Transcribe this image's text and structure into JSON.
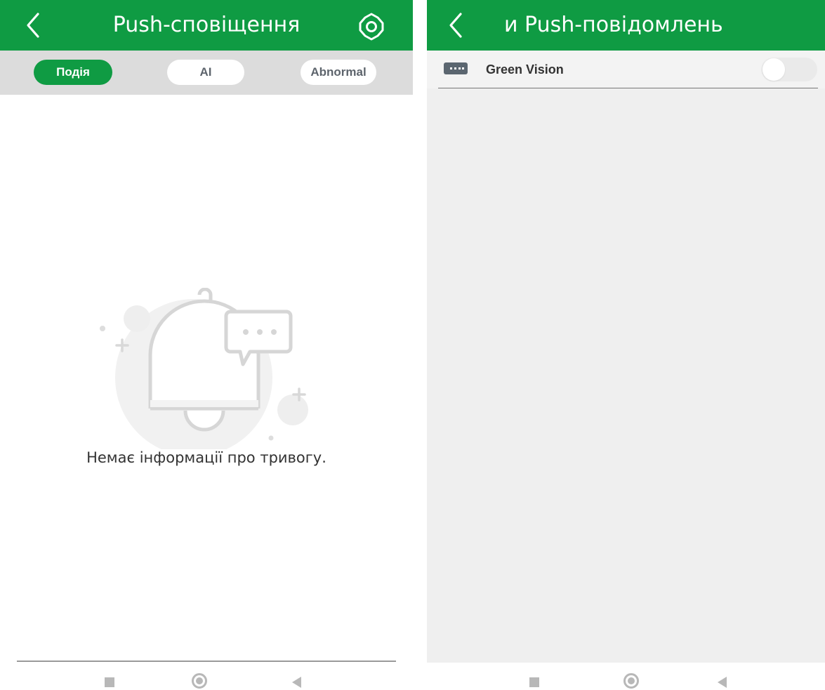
{
  "left_screen": {
    "header": {
      "title": "Push-сповіщення",
      "back_icon": "chevron-left-icon",
      "settings_icon": "gear-icon"
    },
    "tabs": [
      {
        "label": "Подія",
        "active": true
      },
      {
        "label": "AI",
        "active": false
      },
      {
        "label": "Abnormal",
        "active": false
      }
    ],
    "empty_state": {
      "icon": "bell-with-chat-icon",
      "message": "Немає інформації про тривогу."
    }
  },
  "right_screen": {
    "header": {
      "title": "и Push-повідомлень",
      "back_icon": "chevron-left-icon"
    },
    "devices": [
      {
        "name": "Green Vision",
        "icon": "device-icon",
        "push_enabled": false
      }
    ]
  },
  "system_nav": {
    "buttons": [
      "recent-apps",
      "home",
      "back"
    ]
  },
  "colors": {
    "brand_green": "#0f9b43",
    "tab_bar_bg": "#dcdcdc",
    "tab_inactive_text": "#5d646c",
    "list_bg": "#efefef"
  }
}
